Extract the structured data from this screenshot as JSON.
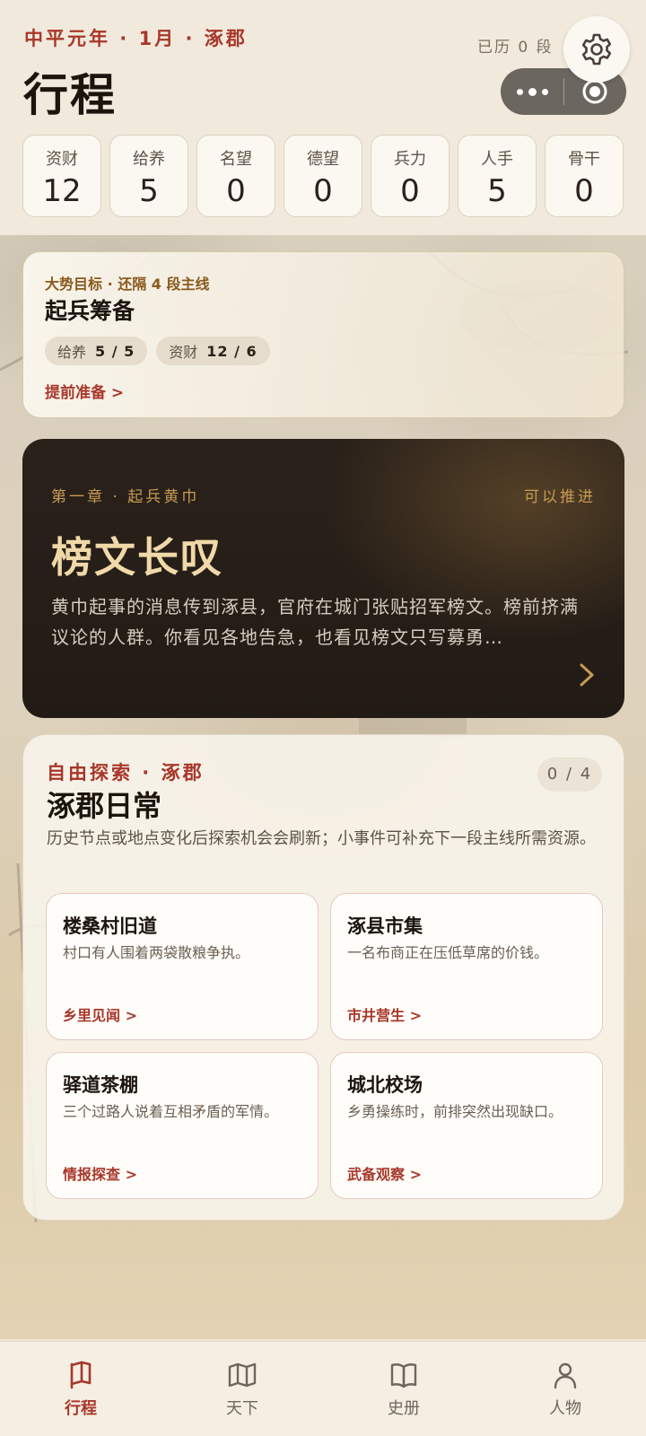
{
  "header": {
    "era": "中平元年 · 1月 · 涿郡",
    "title": "行程",
    "history_count": "已历 0 段"
  },
  "stats": [
    {
      "label": "资财",
      "value": "12"
    },
    {
      "label": "给养",
      "value": "5"
    },
    {
      "label": "名望",
      "value": "0"
    },
    {
      "label": "德望",
      "value": "0"
    },
    {
      "label": "兵力",
      "value": "0"
    },
    {
      "label": "人手",
      "value": "5"
    },
    {
      "label": "骨干",
      "value": "0"
    }
  ],
  "goal": {
    "subtitle": "大势目标 · 还隔 4 段主线",
    "title": "起兵筹备",
    "requirements": [
      {
        "label": "给养",
        "value": "5 / 5"
      },
      {
        "label": "资财",
        "value": "12 / 6"
      }
    ],
    "link": "提前准备 >"
  },
  "chapter": {
    "crumb": "第一章 · 起兵黄巾",
    "status": "可以推进",
    "title": "榜文长叹",
    "description": "黄巾起事的消息传到涿县，官府在城门张贴招军榜文。榜前挤满议论的人群。你看见各地告急，也看见榜文只写募勇…"
  },
  "explore": {
    "crumb": "自由探索 · 涿郡",
    "title": "涿郡日常",
    "counter": "0 / 4",
    "description": "历史节点或地点变化后探索机会会刷新；小事件可补充下一段主线所需资源。",
    "spots": [
      {
        "name": "楼桑村旧道",
        "text": "村口有人围着两袋散粮争执。",
        "link": "乡里见闻 >"
      },
      {
        "name": "涿县市集",
        "text": "一名布商正在压低草席的价钱。",
        "link": "市井营生 >"
      },
      {
        "name": "驿道茶棚",
        "text": "三个过路人说着互相矛盾的军情。",
        "link": "情报探查 >"
      },
      {
        "name": "城北校场",
        "text": "乡勇操练时，前排突然出现缺口。",
        "link": "武备观察 >"
      }
    ]
  },
  "tabs": [
    {
      "label": "行程",
      "icon": "flag-icon",
      "active": true
    },
    {
      "label": "天下",
      "icon": "map-icon",
      "active": false
    },
    {
      "label": "史册",
      "icon": "book-icon",
      "active": false
    },
    {
      "label": "人物",
      "icon": "person-icon",
      "active": false
    }
  ],
  "colors": {
    "accent_red": "#a8372a",
    "gold": "#c89b55",
    "chapter_bg": "#221b15",
    "page_bg": "#efe7d6"
  }
}
